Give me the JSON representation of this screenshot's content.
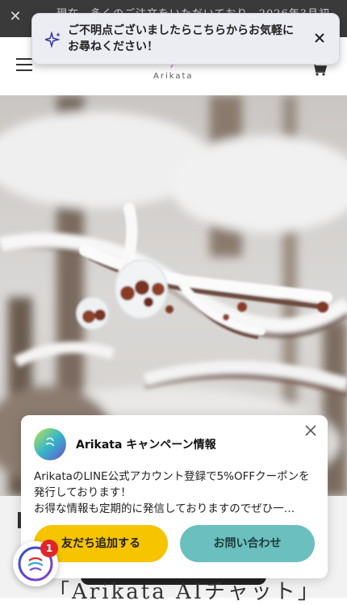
{
  "announcement": {
    "text": "現在、多くのご注文をいただいており、2026年3月初",
    "close_label": "✕"
  },
  "header": {
    "logo_text": "Arikata"
  },
  "toast": {
    "message": "ご不明点ございましたらこちらからお気軽にお尋ねください！"
  },
  "popup": {
    "title": "Arikata キャンペーン情報",
    "body_line1": "ArikataのLINE公式アカウント登録で5%OFFクーポンを",
    "body_line2": "発行しております！",
    "body_line3": "お得な情報も定期的に発信しておりますのでぜひ一…",
    "add_friend_label": "友だち追加する",
    "contact_label": "お問い合わせ"
  },
  "below": {
    "title": "「Arikata AIチャット」"
  },
  "launcher": {
    "badge_count": "1"
  },
  "colors": {
    "announcement_bg": "#3a3a3a",
    "add_button": "#f7c400",
    "contact_button": "#6bbfbe",
    "badge": "#e0262a"
  }
}
